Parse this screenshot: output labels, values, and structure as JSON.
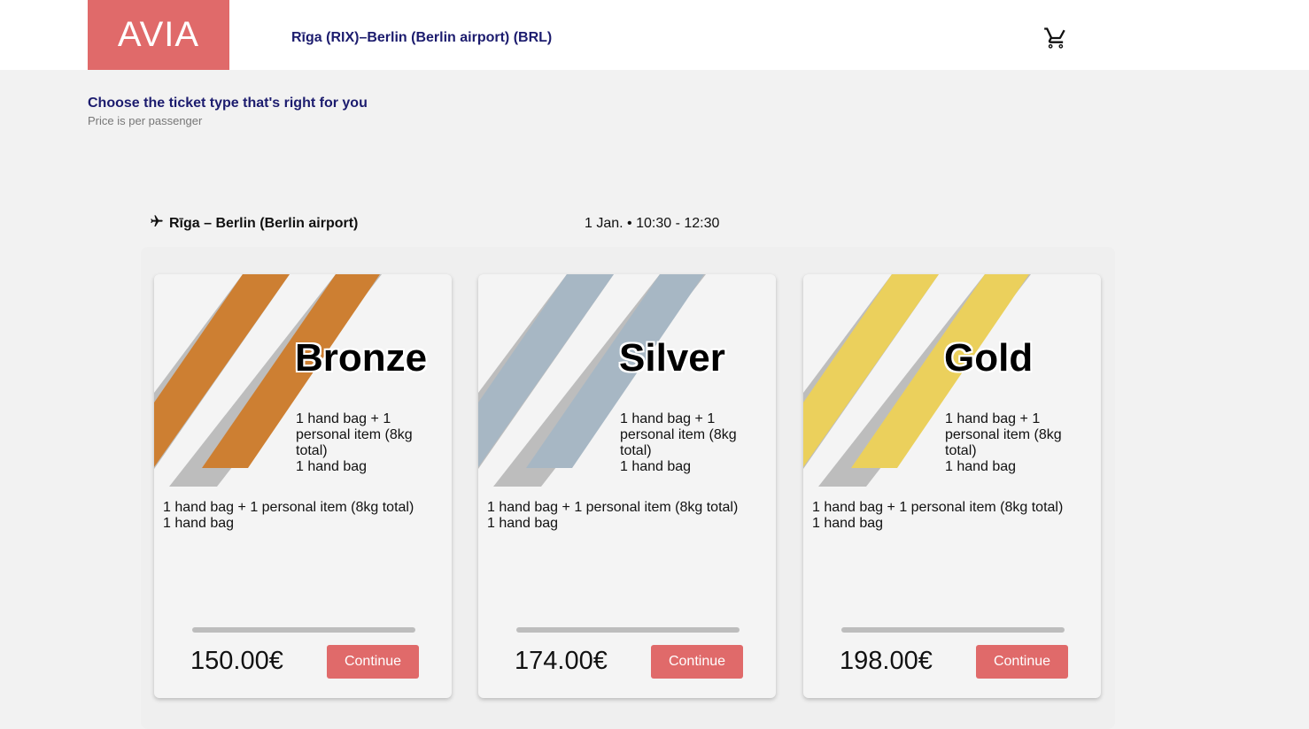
{
  "header": {
    "logo": "AVIA",
    "route": "Rīga (RIX)–Berlin (Berlin airport) (BRL)",
    "cart_icon": "shopping-cart-icon"
  },
  "intro": {
    "title": "Choose the ticket type that's right for you",
    "subtitle": "Price is per passenger"
  },
  "flight": {
    "plane_icon": "airplane-icon",
    "route": "Rīga – Berlin (Berlin airport)",
    "datetime": "1 Jan. • 10:30 - 12:30"
  },
  "cards": [
    {
      "tier": "Bronze",
      "accent": "#cd7f32",
      "badge_line1": "1 hand bag + 1 personal item (8kg total)",
      "badge_line2": "1 hand bag",
      "feature_line1": "1 hand bag + 1 personal item (8kg total)",
      "feature_line2": "1 hand bag",
      "price": "150.00€",
      "cta": "Continue"
    },
    {
      "tier": "Silver",
      "accent": "#a7b7c4",
      "badge_line1": "1 hand bag + 1 personal item (8kg total)",
      "badge_line2": "1 hand bag",
      "feature_line1": "1 hand bag + 1 personal item (8kg total)",
      "feature_line2": "1 hand bag",
      "price": "174.00€",
      "cta": "Continue"
    },
    {
      "tier": "Gold",
      "accent": "#ebd05c",
      "badge_line1": "1 hand bag + 1 personal item (8kg total)",
      "badge_line2": "1 hand bag",
      "feature_line1": "1 hand bag + 1 personal item (8kg total)",
      "feature_line2": "1 hand bag",
      "price": "198.00€",
      "cta": "Continue"
    }
  ],
  "colors": {
    "brand": "#e06a6a",
    "heading": "#1c1c6e",
    "stripe_grey": "#bdbdbd"
  }
}
